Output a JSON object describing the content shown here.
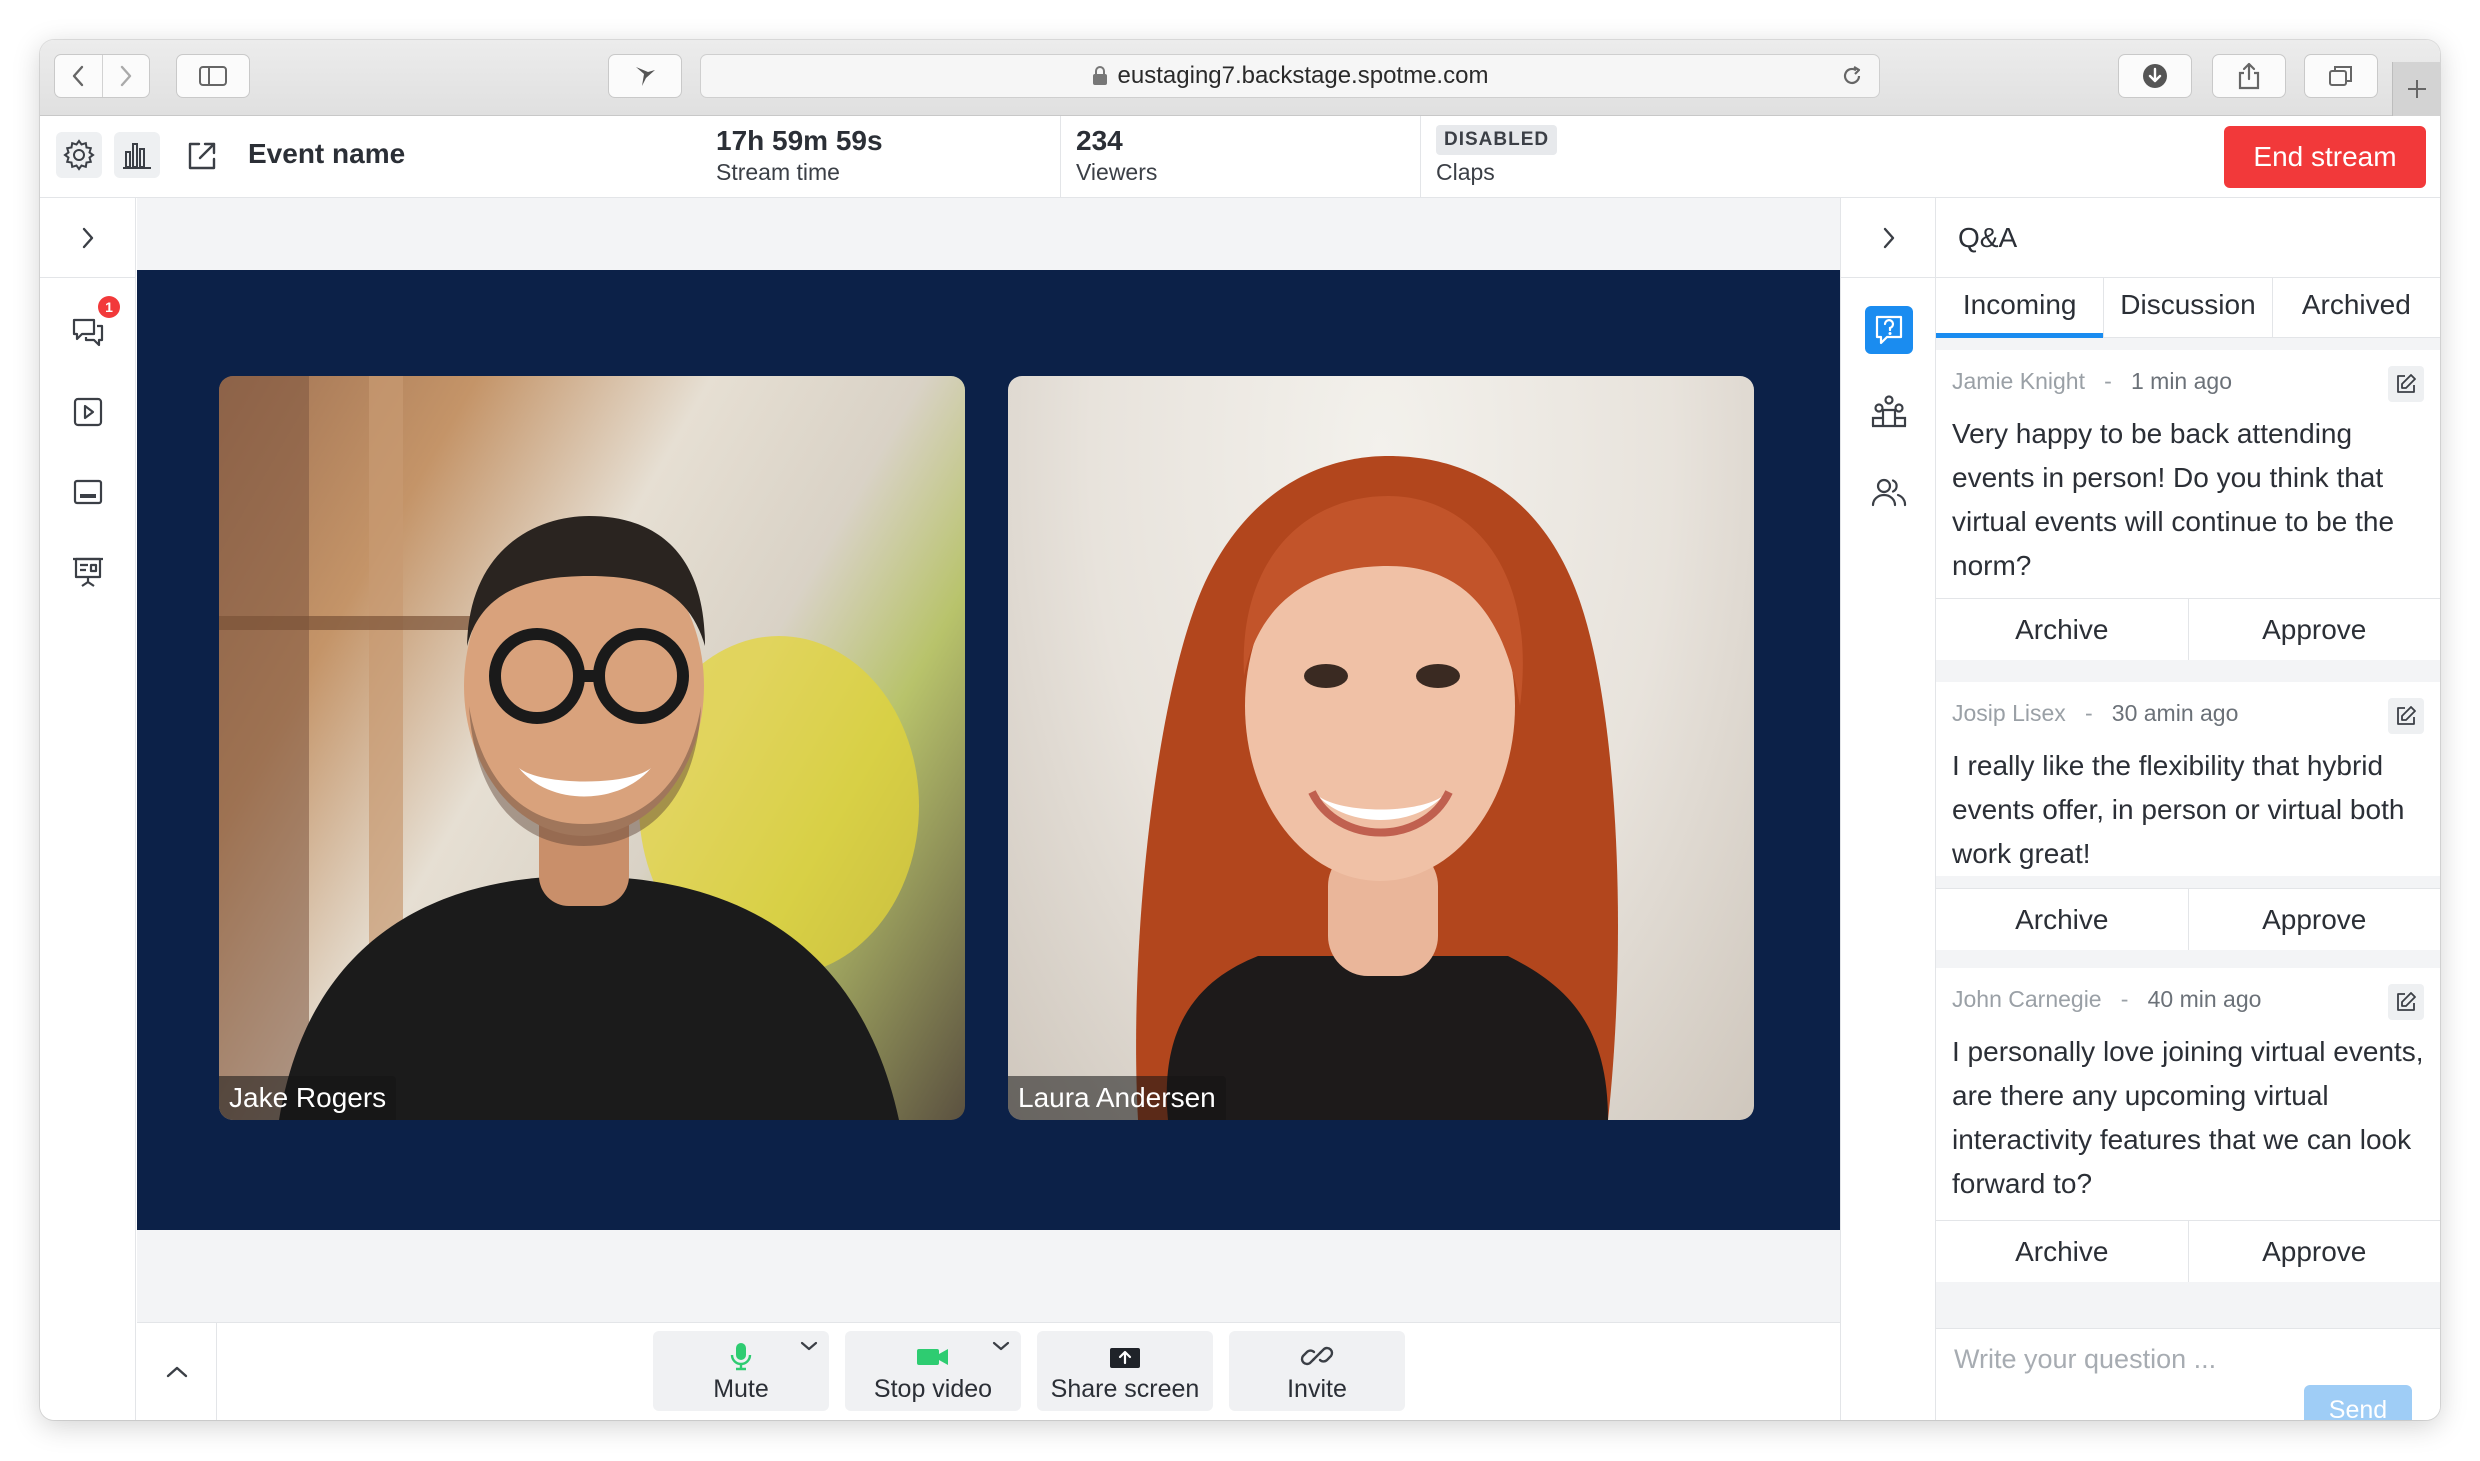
{
  "browser": {
    "url": "eustaging7.backstage.spotme.com"
  },
  "header": {
    "event_name": "Event name",
    "stream_time_value": "17h 59m 59s",
    "stream_time_label": "Stream time",
    "viewers_value": "234",
    "viewers_label": "Viewers",
    "claps_badge": "DISABLED",
    "claps_label": "Claps",
    "end_stream_label": "End stream",
    "end_stream_color": "#f2393a"
  },
  "left_rail": {
    "notification_count": "1"
  },
  "stage": {
    "background_color": "#0c2148",
    "participants": [
      {
        "name": "Jake Rogers"
      },
      {
        "name": "Laura Andersen"
      }
    ]
  },
  "controls": {
    "mute_label": "Mute",
    "stop_video_label": "Stop video",
    "share_screen_label": "Share screen",
    "invite_label": "Invite"
  },
  "qa": {
    "title": "Q&A",
    "tabs": [
      "Incoming",
      "Discussion",
      "Archived"
    ],
    "active_tab": "Incoming",
    "accent_color": "#1a8cf0",
    "questions": [
      {
        "author": "Jamie Knight",
        "time": "1 min  ago",
        "text": "Very happy to be back attending events in person! Do you think that virtual events will continue to be the norm?",
        "archive_label": "Archive",
        "approve_label": "Approve"
      },
      {
        "author": "Josip Lisex",
        "time": "30 amin ago",
        "text": "I really like the flexibility that hybrid events offer, in person or virtual both work great!",
        "archive_label": "Archive",
        "approve_label": "Approve"
      },
      {
        "author": "John Carnegie",
        "time": "40 min ago",
        "text": "I personally love joining virtual events,  are there any upcoming virtual interactivity features that we can look forward to?",
        "archive_label": "Archive",
        "approve_label": "Approve"
      }
    ],
    "composer_placeholder": "Write your question ...",
    "send_label": "Send"
  }
}
